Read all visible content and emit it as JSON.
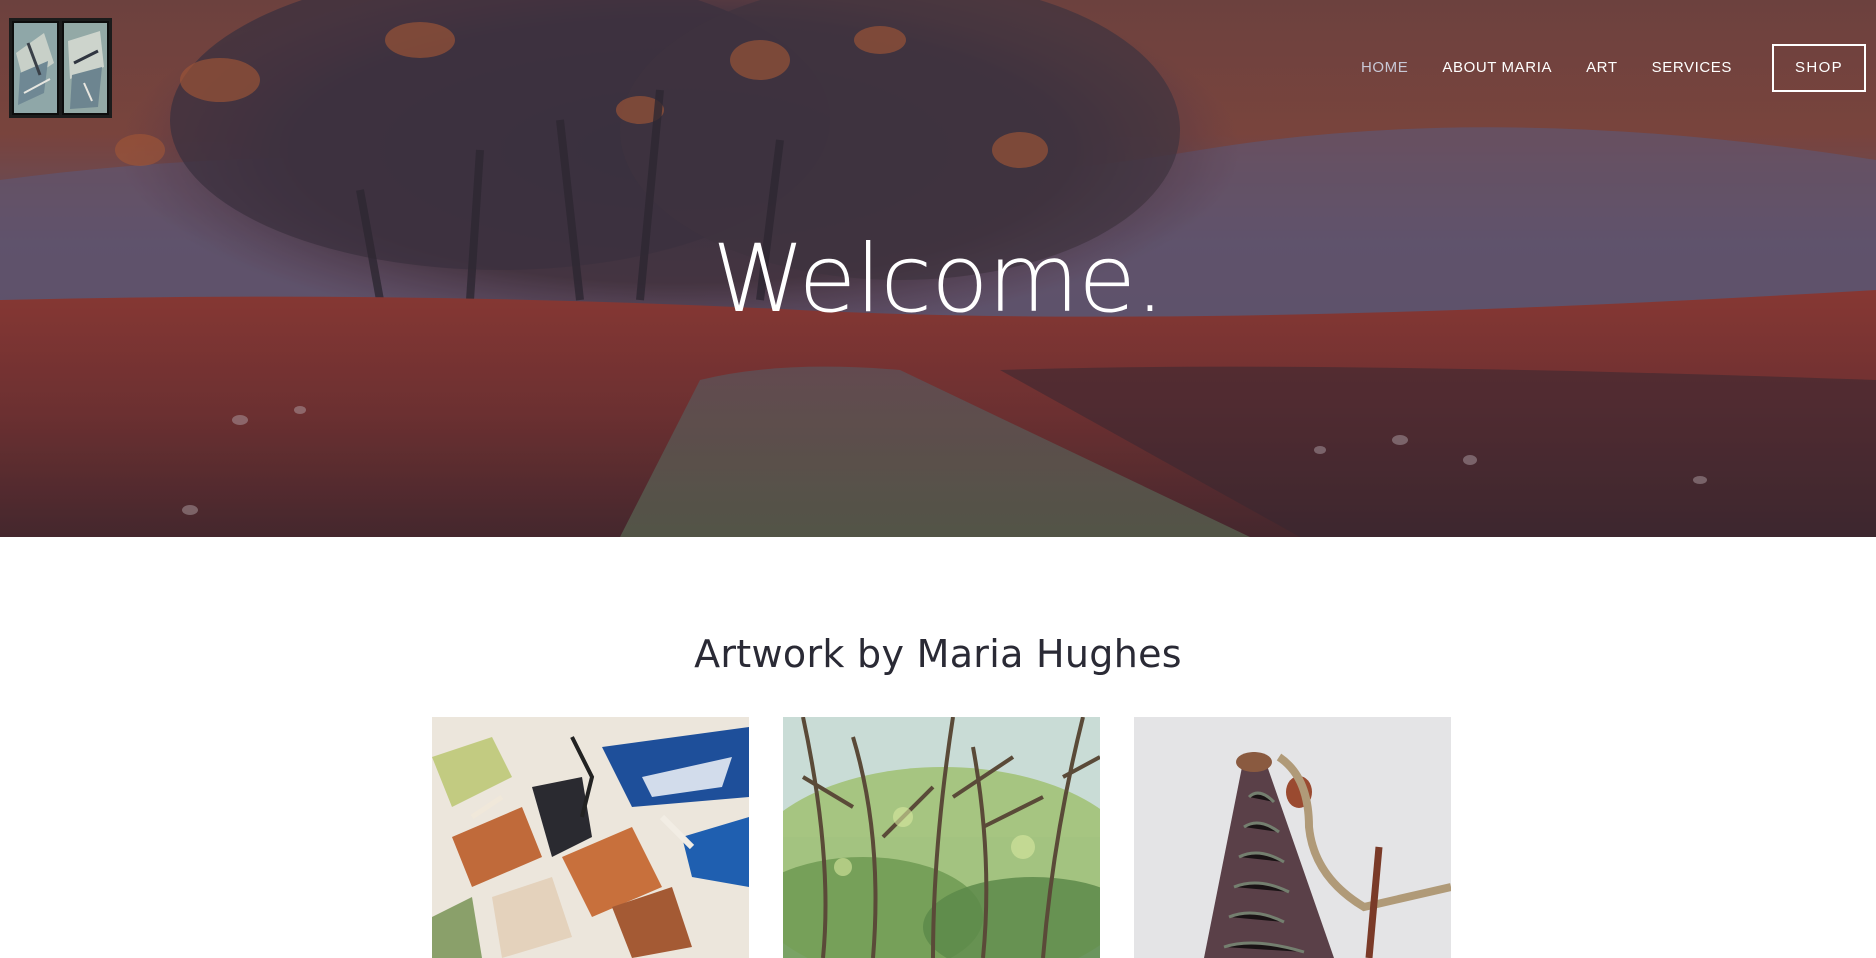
{
  "nav": {
    "items": [
      {
        "label": "HOME",
        "active": true
      },
      {
        "label": "ABOUT MARIA",
        "active": false
      },
      {
        "label": "ART",
        "active": false
      },
      {
        "label": "SERVICES",
        "active": false
      }
    ],
    "shop_label": "SHOP"
  },
  "hero": {
    "title": "Welcome."
  },
  "artwork": {
    "title": "Artwork by Maria Hughes",
    "items": [
      {
        "name": "abstract-painting"
      },
      {
        "name": "trees-painting"
      },
      {
        "name": "ceramic-sculpture"
      }
    ]
  },
  "colors": {
    "hero_overlay": "#5a3a44",
    "accent_text": "#ffffff",
    "active_nav": "#c8c8d6",
    "section_title": "#2a2a35"
  }
}
